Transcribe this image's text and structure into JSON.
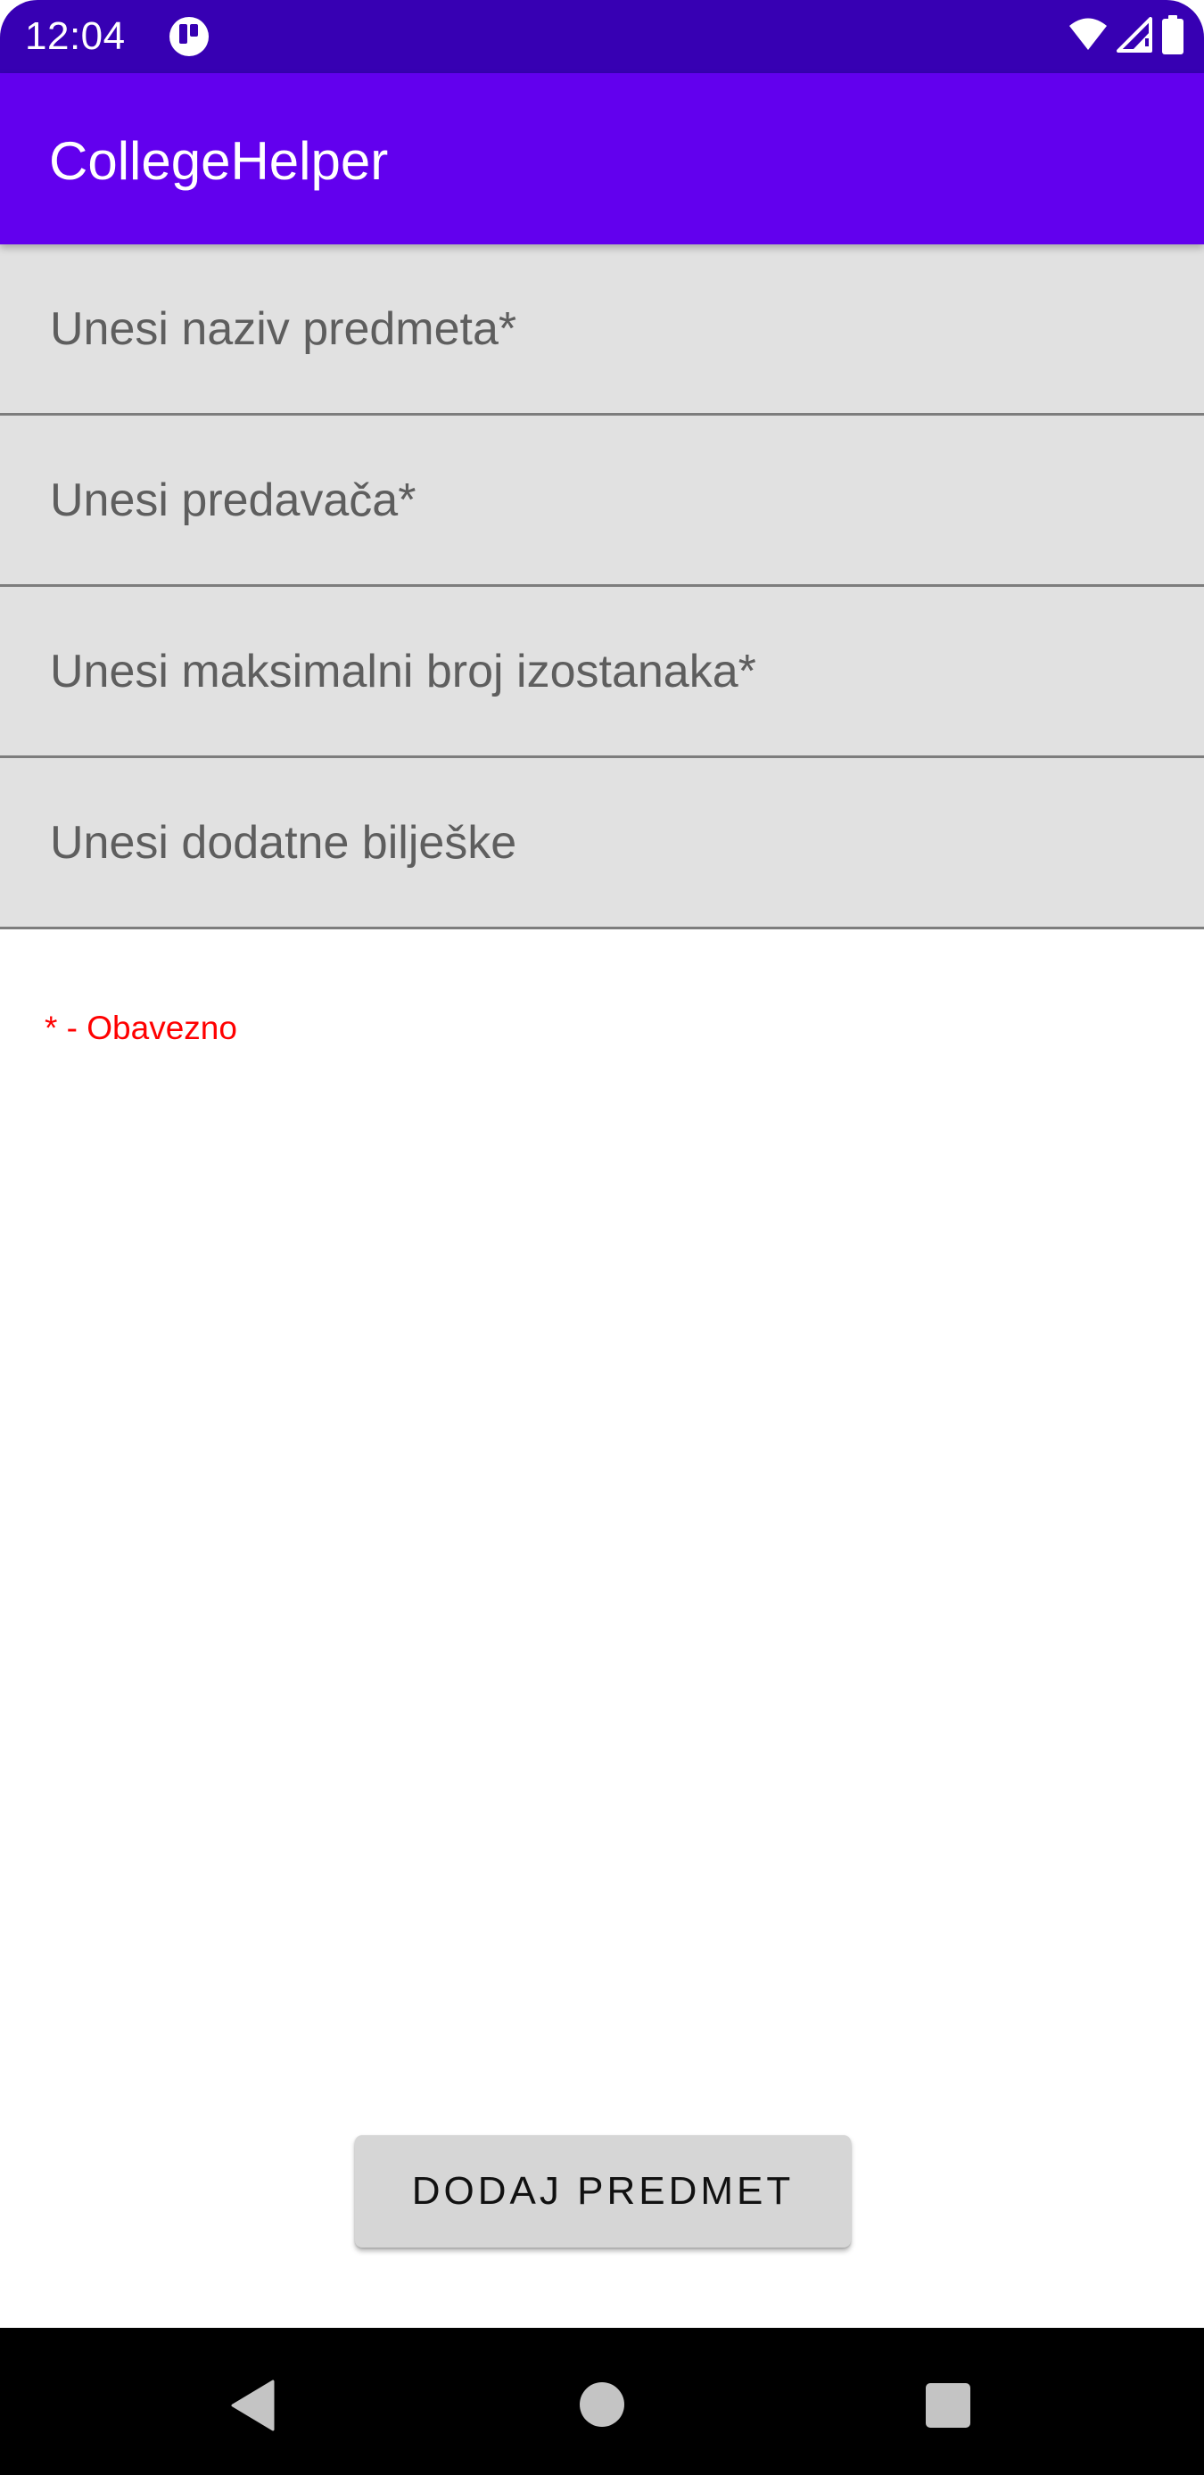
{
  "status_bar": {
    "time": "12:04",
    "app_icon": "bubble-app-icon",
    "wifi_icon": "wifi-icon",
    "signal_icon": "cell-signal-icon",
    "battery_icon": "battery-icon"
  },
  "app_bar": {
    "title": "CollegeHelper",
    "color": "#6200ee"
  },
  "form": {
    "fields": [
      {
        "value": "",
        "placeholder": "Unesi naziv predmeta*"
      },
      {
        "value": "",
        "placeholder": "Unesi predavača*"
      },
      {
        "value": "",
        "placeholder": "Unesi maksimalni broj izostanaka*"
      },
      {
        "value": "",
        "placeholder": "Unesi dodatne bilješke"
      }
    ],
    "required_note": "* - Obavezno",
    "required_note_color": "#ff0000",
    "submit_label": "DODAJ PREDMET"
  },
  "nav_bar": {
    "back_icon": "back-triangle-icon",
    "home_icon": "home-circle-icon",
    "recents_icon": "recents-square-icon"
  }
}
